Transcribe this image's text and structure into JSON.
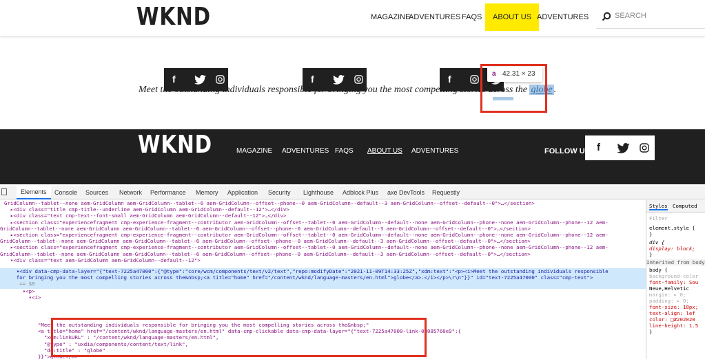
{
  "site": {
    "logo": "WKND",
    "nav": [
      "MAGAZINE",
      "ADVENTURES",
      "FAQS",
      "ABOUT US",
      "ADVENTURES"
    ],
    "search_placeholder": "SEARCH",
    "quote_text": "Meet the outstanding individuals responsible for bringing you the most compelling stories across the",
    "quote_link": "globe",
    "quote_end": ".",
    "tooltip_tag": "a",
    "tooltip_size": "42.31 × 23",
    "social_icons": [
      "f",
      "twitter-icon",
      "instagram-icon"
    ]
  },
  "footer": {
    "logo": "WKND",
    "nav": [
      "MAGAZINE",
      "ADVENTURES",
      "FAQS",
      "ABOUT US",
      "ADVENTURES"
    ],
    "follow": "FOLLOW US"
  },
  "devtools": {
    "tabs": [
      "Elements",
      "Console",
      "Sources",
      "Network",
      "Performance",
      "Memory",
      "Application",
      "Security",
      "Lighthouse",
      "Adblock Plus",
      "axe DevTools",
      "Requestly"
    ],
    "dom": [
      "GridColumn--tablet--none aem-GridColumn aem-GridColumn--tablet--6 aem-GridColumn--offset--phone--0 aem-GridColumn--default--3 aem-GridColumn--offset--default--0\">…</section>",
      "  ▸<div class=\"title cmp-title--underline aem-GridColumn aem-GridColumn--default--12\">…</div>",
      "  ▸<div class=\"text cmp-text--font-small aem-GridColumn aem-GridColumn--default--12\">…</div>",
      "  ▸<section class=\"experiencefragment cmp-experience-fragment--contributor aem-GridColumn--offset--tablet--0 aem-GridColumn--default--none aem-GridColumn--phone--none aem-GridColumn--phone--12 aem-",
      "GridColumn--tablet--none aem-GridColumn aem-GridColumn--tablet--6 aem-GridColumn--offset--phone--0 aem-GridColumn--default--3 aem-GridColumn--offset--default--0\">…</section>",
      "  ▸<section class=\"experiencefragment cmp-experience-fragment--contributor aem-GridColumn--offset--tablet--0 aem-GridColumn--default--none aem-GridColumn--phone--none aem-GridColumn--phone--12 aem-",
      "GridColumn--tablet--none aem-GridColumn aem-GridColumn--tablet--6 aem-GridColumn--offset--phone--0 aem-GridColumn--default--3 aem-GridColumn--offset--default--0\">…</section>",
      "  ▸<section class=\"experiencefragment cmp-experience-fragment--contributor aem-GridColumn--offset--tablet--0 aem-GridColumn--default--none aem-GridColumn--phone--none aem-GridColumn--phone--12 aem-",
      "GridColumn--tablet--none aem-GridColumn aem-GridColumn--tablet--6 aem-GridColumn--offset--phone--0 aem-GridColumn--default--3 aem-GridColumn--offset--default--0\">…</section>",
      "  ▾<div class=\"text aem-GridColumn aem-GridColumn--default--12\">"
    ],
    "selected": [
      "    ▾<div data-cmp-data-layer=\"{\"text-7225a47000\":{\"@type\":\"core/wcm/components/text/v2/text\",\"repo:modifyDate\":\"2021-11-09T14:33:25Z\",\"xdm:text\":\"<p><i>Meet the outstanding individuals responsible",
      "    for bringing you the most compelling stories across the&nbsp;<a title=\"home\" href=\"/content/wknd/language-masters/en.html\">globe</a>.</i></p>\\r\\n\"}}\" id=\"text-7225a47000\" class=\"cmp-text\">",
      "     == $0"
    ],
    "tail": [
      "      ▾<p>",
      "        ▾<i>",
      "           \"Meet the outstanding individuals responsible for bringing you the most compelling stories across the&nbsp;\"",
      "           <a title=\"home\" href=\"/content/wknd/language-masters/en.html\" data-cmp-clickable data-cmp-data-layer=\"{\"text-7225a47000-link-0d085760e9\":{",
      "             \"xdm:linkURL\" : \"/content/wknd/language-masters/en.html\",",
      "             \"@type\" : \"uxdia/components/content/text/link\",",
      "             \"dc:title\" : \"globe\"",
      "           }}\">globe</a>",
      "        </i>"
    ],
    "styles": {
      "tabs": [
        "Styles",
        "Computed"
      ],
      "filter": "Filter",
      "lines": [
        "element.style {",
        "}",
        "div {",
        "  display: block;",
        "}",
        "Inherited from body#p",
        "body {",
        "  background-color",
        "  font-family: Sou",
        "    Neue,Helvetic",
        "  margin: ▸ 0;",
        "  padding: ▸ 0;",
        "  font-size: 18px;",
        "  text-align: lef",
        "  color: □#202020",
        "  line-height: 1.5",
        "}"
      ]
    }
  }
}
